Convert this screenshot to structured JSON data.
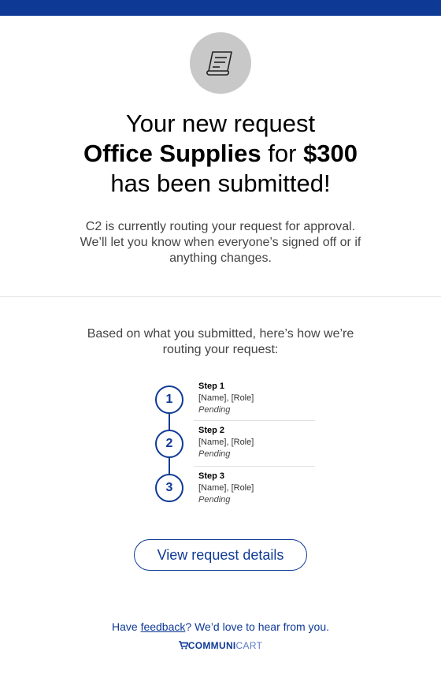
{
  "header": {
    "bar_color": "#0e3a96"
  },
  "hero": {
    "icon": "receipt-icon",
    "line1": "Your new request",
    "request_name": "Office Supplies",
    "for_word": "for",
    "amount": "$300",
    "line3": "has been submitted!"
  },
  "intro": {
    "line1": "C2 is currently routing your request for approval.",
    "line2": "We’ll let you know when everyone’s signed off or if anything changes."
  },
  "routing": {
    "text": "Based on what you submitted, here’s how we’re routing your request:",
    "steps": [
      {
        "number": "1",
        "title": "Step 1",
        "person": "[Name], [Role]",
        "status": "Pending"
      },
      {
        "number": "2",
        "title": "Step 2",
        "person": "[Name], [Role]",
        "status": "Pending"
      },
      {
        "number": "3",
        "title": "Step 3",
        "person": "[Name], [Role]",
        "status": "Pending"
      }
    ]
  },
  "cta": {
    "label": "View request details"
  },
  "footer": {
    "before_link": "Have ",
    "link_text": "feedback",
    "after_link": "? We’d love to hear from you.",
    "brand_bold": "COMMUNI",
    "brand_light": "CART",
    "brand_icon": "cart-icon"
  },
  "colors": {
    "accent": "#0e3a96",
    "icon_bg": "#c8c8c8",
    "text_muted": "#444444"
  }
}
